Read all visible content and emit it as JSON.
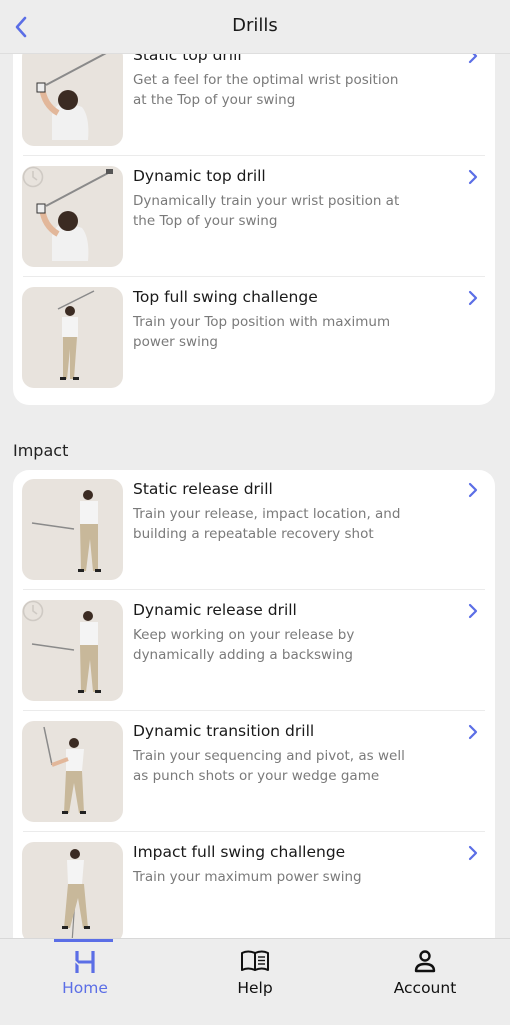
{
  "header": {
    "title": "Drills",
    "back_icon": "chevron-left-icon"
  },
  "colors": {
    "accent": "#5b6ee6",
    "background": "#ededed",
    "card": "#ffffff",
    "thumbnail_bg": "#e8e3dd",
    "description": "#7a7a7a"
  },
  "sections": [
    {
      "label": "",
      "items": [
        {
          "title": "Static top drill",
          "description": "Get a feel for the optimal wrist position at the Top of your swing",
          "timed": false,
          "pose": "top-closeup"
        },
        {
          "title": "Dynamic top drill",
          "description": "Dynamically train your wrist position at the Top of your swing",
          "timed": true,
          "pose": "top-closeup"
        },
        {
          "title": "Top full swing challenge",
          "description": "Train your Top position with maximum power swing",
          "timed": false,
          "pose": "top-full"
        }
      ]
    },
    {
      "label": "Impact",
      "items": [
        {
          "title": "Static release drill",
          "description": "Train your release, impact location, and building a repeatable recovery shot",
          "timed": false,
          "pose": "release"
        },
        {
          "title": "Dynamic release drill",
          "description": "Keep working on your release by dynamically adding a backswing",
          "timed": true,
          "pose": "release"
        },
        {
          "title": "Dynamic transition drill",
          "description": "Train your sequencing and pivot, as well as punch shots or your wedge game",
          "timed": false,
          "pose": "transition"
        },
        {
          "title": "Impact full swing challenge",
          "description": "Train your maximum power swing",
          "timed": false,
          "pose": "impact"
        }
      ]
    }
  ],
  "tabbar": {
    "tabs": [
      {
        "label": "Home",
        "icon": "home-logo-icon",
        "active": true
      },
      {
        "label": "Help",
        "icon": "book-icon",
        "active": false
      },
      {
        "label": "Account",
        "icon": "person-icon",
        "active": false
      }
    ]
  }
}
